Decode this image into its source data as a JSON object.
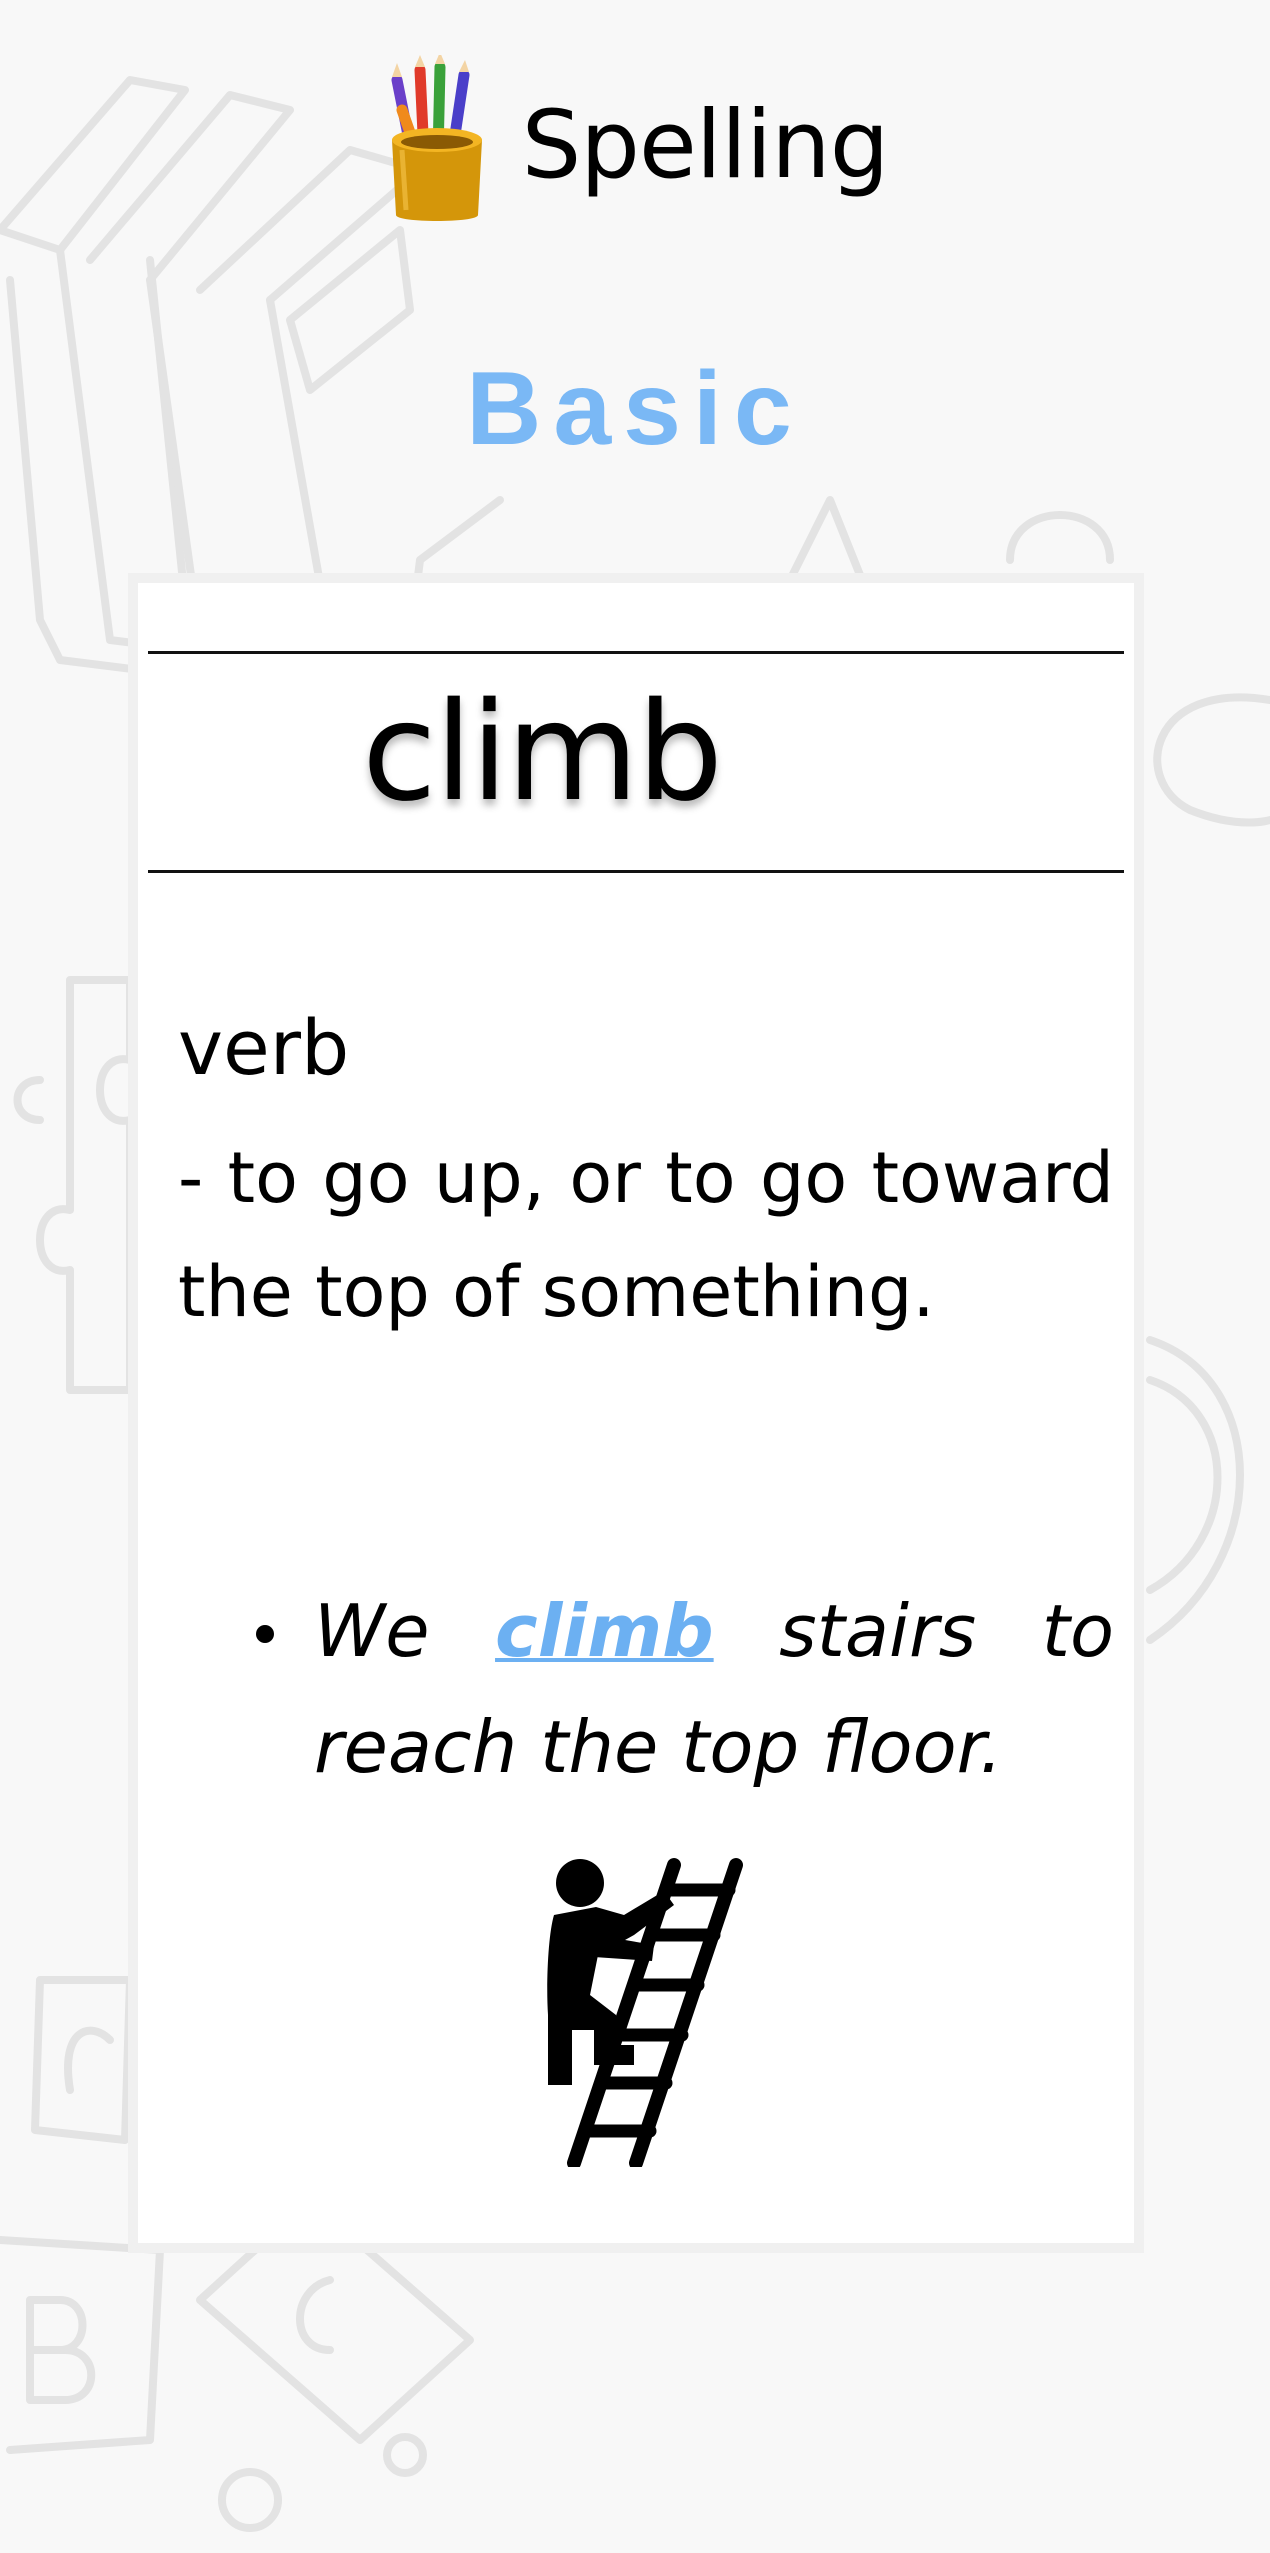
{
  "app": {
    "title": "Spelling",
    "icon": "pencil-cup-icon"
  },
  "level": {
    "label": "Basic",
    "color": "#7ab8f5"
  },
  "card": {
    "word": "climb",
    "part_of_speech": "verb",
    "definition": " - to go up, or to go toward the top of something.",
    "example": {
      "before": "We ",
      "highlight": "climb",
      "after": " stairs to reach the top floor."
    },
    "illustration": "person-climbing-ladder-icon",
    "highlight_color": "#6cb0f2"
  }
}
